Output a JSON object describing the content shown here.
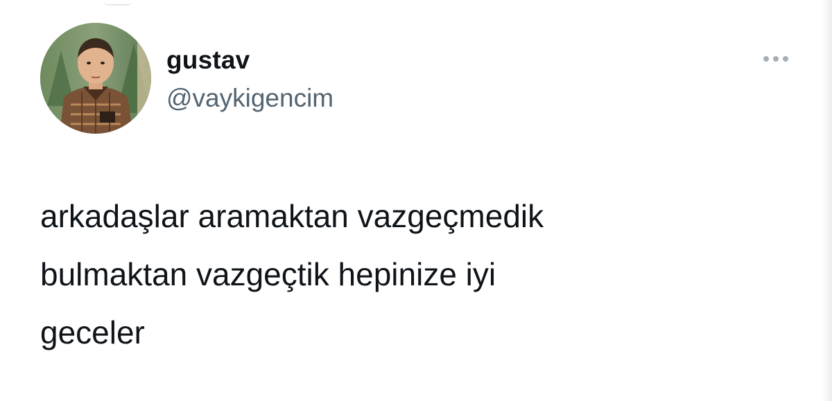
{
  "tweet": {
    "author": {
      "display_name": "gustav",
      "handle": "@vaykigencim",
      "avatar_icon": "child-photo-avatar"
    },
    "more_icon": "more-horizontal-icon",
    "text_lines": [
      "arkadaşlar aramaktan vazgeçmedik",
      "bulmaktan vazgeçtik hepinize iyi",
      "geceler"
    ]
  },
  "colors": {
    "text_primary": "#0f1419",
    "text_secondary": "#536471",
    "icon_muted": "#a7afb6",
    "background": "#ffffff"
  }
}
